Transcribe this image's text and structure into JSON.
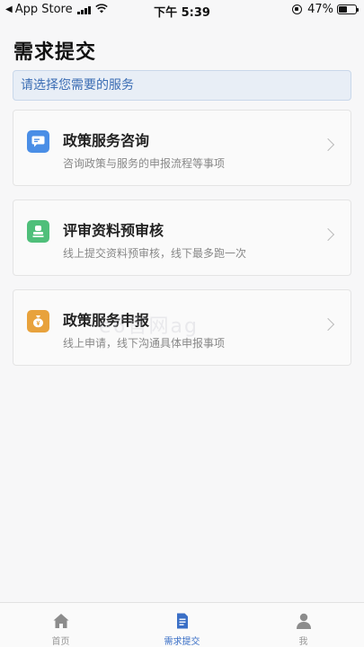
{
  "status_bar": {
    "carrier": "App Store",
    "time": "下午 5:39",
    "battery": "47%"
  },
  "page": {
    "title": "需求提交",
    "hint": "请选择您需要的服务"
  },
  "cards": [
    {
      "title": "政策服务咨询",
      "desc": "咨询政策与服务的申报流程等事项",
      "icon": "chat-bubble-icon",
      "color": "#4a8ee6"
    },
    {
      "title": "评审资料预审核",
      "desc": "线上提交资料预审核，线下最多跑一次",
      "icon": "stamp-icon",
      "color": "#4fbf7a"
    },
    {
      "title": "政策服务申报",
      "desc": "线上申请，线下沟通具体申报事项",
      "icon": "money-bag-icon",
      "color": "#e8a23c"
    }
  ],
  "tabs": [
    {
      "label": "首页",
      "icon": "home-icon"
    },
    {
      "label": "需求提交",
      "icon": "document-icon",
      "active": true
    },
    {
      "label": "我",
      "icon": "user-icon"
    }
  ],
  "watermark": "e6官网ag"
}
